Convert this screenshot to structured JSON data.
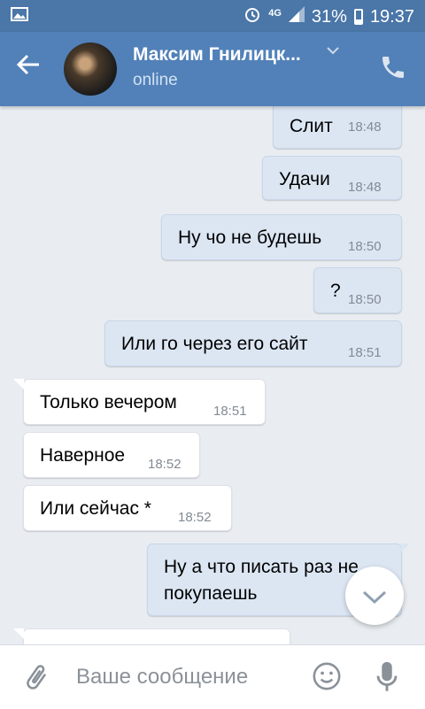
{
  "status_bar": {
    "time": "19:37",
    "battery": "31%",
    "network": "4G",
    "battery_level": 0.31
  },
  "header": {
    "name": "Максим Гнилицк...",
    "status": "online"
  },
  "composer": {
    "placeholder": "Ваше сообщение"
  },
  "messages": [
    {
      "dir": "out",
      "text": "Слит",
      "time": "18:48"
    },
    {
      "dir": "out",
      "text": "Удачи",
      "time": "18:48"
    },
    {
      "dir": "out",
      "text": "Ну чо не будешь",
      "time": "18:50"
    },
    {
      "dir": "out",
      "text": "?",
      "time": "18:50"
    },
    {
      "dir": "out",
      "text": "Или го через его сайт",
      "time": "18:51"
    },
    {
      "dir": "in",
      "text": "Только вечером",
      "time": "18:51"
    },
    {
      "dir": "in",
      "text": "Наверное",
      "time": "18:52"
    },
    {
      "dir": "in",
      "text": "Или сейчас *",
      "time": "18:52"
    },
    {
      "dir": "out",
      "text": "Ну а что писать раз не",
      "text2": "покупаешь",
      "time": ""
    },
    {
      "dir": "in",
      "text": "",
      "time": ""
    }
  ],
  "colors": {
    "header": "#5181b8",
    "status_bar": "#4a76a8",
    "outgoing_bubble": "#dce6f3",
    "incoming_bubble": "#ffffff",
    "background": "#e9edf1"
  },
  "icons": {
    "back": "arrow-left",
    "phone": "phone",
    "dropdown": "chevron-down",
    "attach": "paperclip",
    "emoji": "smiley",
    "mic": "microphone",
    "scroll": "chevron-down"
  }
}
